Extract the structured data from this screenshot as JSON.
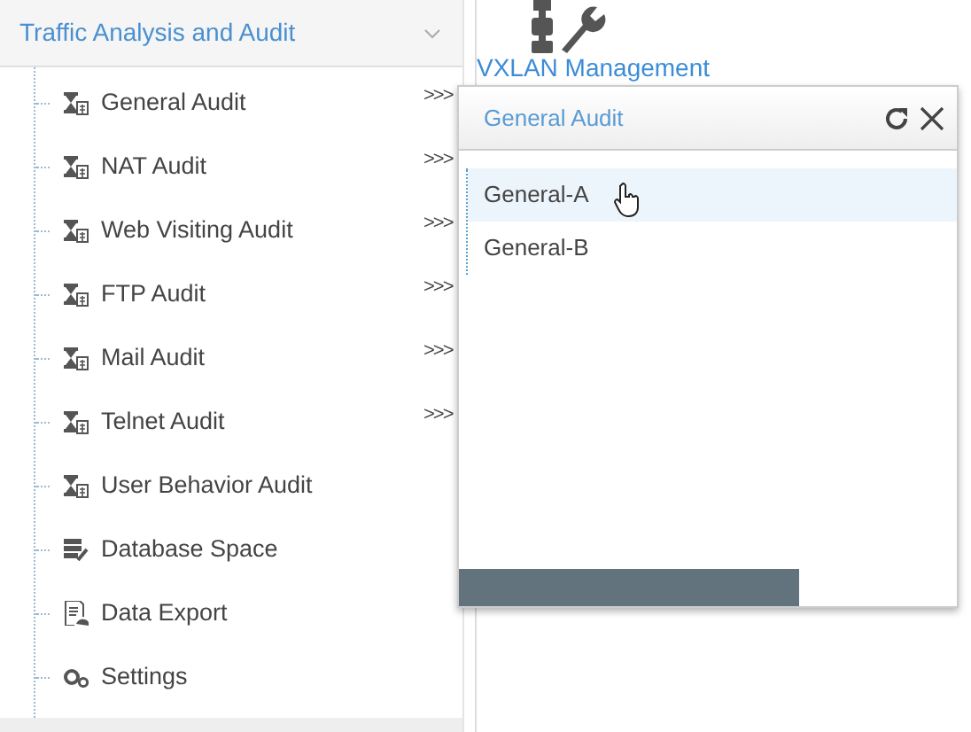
{
  "sidebar": {
    "title": "Traffic Analysis and Audit",
    "expanded": true,
    "items": [
      {
        "label": "General Audit",
        "kind": "audit",
        "submenu": ">>>"
      },
      {
        "label": "NAT Audit",
        "kind": "audit",
        "submenu": ">>>"
      },
      {
        "label": "Web Visiting Audit",
        "kind": "audit",
        "submenu": ">>>"
      },
      {
        "label": "FTP Audit",
        "kind": "audit",
        "submenu": ">>>"
      },
      {
        "label": "Mail Audit",
        "kind": "audit",
        "submenu": ">>>"
      },
      {
        "label": "Telnet Audit",
        "kind": "audit",
        "submenu": ">>>"
      },
      {
        "label": "User Behavior Audit",
        "kind": "audit"
      },
      {
        "label": "Database Space",
        "kind": "database"
      },
      {
        "label": "Data Export",
        "kind": "export"
      },
      {
        "label": "Settings",
        "kind": "settings"
      }
    ]
  },
  "main": {
    "tile": {
      "label": "VXLAN Management"
    }
  },
  "popup": {
    "title": "General Audit",
    "items": [
      {
        "label": "General-A",
        "selected": true
      },
      {
        "label": "General-B",
        "selected": false
      }
    ]
  }
}
